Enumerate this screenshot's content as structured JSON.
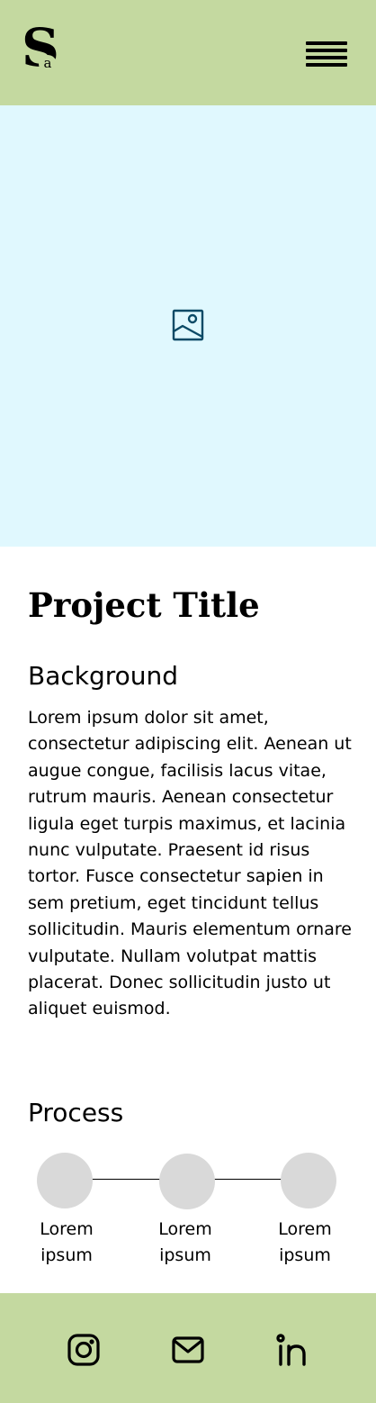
{
  "header": {
    "logo_text_big": "S",
    "logo_text_small": "a",
    "background_color": "#c4d9a0",
    "menu_icon": "hamburger-menu-icon"
  },
  "hero": {
    "background_color": "#e0f8fe",
    "icon": "image-placeholder-icon",
    "icon_color": "#0b4a66"
  },
  "main": {
    "title": "Project Title",
    "background_heading": "Background",
    "background_text": "Lorem ipsum dolor sit amet, consectetur adipiscing elit. Aenean ut augue congue, facilisis lacus vitae, rutrum mauris. Aenean consectetur ligula eget turpis maximus, et lacinia nunc vulputate. Praesent id risus tortor. Fusce consectetur sapien in sem pretium, eget tincidunt tellus sollicitudin. Mauris elementum ornare vulputate. Nullam volutpat mattis placerat. Donec sollicitudin justo ut aliquet euismod.",
    "process_heading": "Process",
    "steps": [
      {
        "label": "Lorem ipsum"
      },
      {
        "label": "Lorem ipsum"
      },
      {
        "label": "Lorem ipsum"
      }
    ],
    "step_circle_color": "#d9d9d9"
  },
  "footer": {
    "background_color": "#c4d9a0",
    "icons": [
      "instagram-icon",
      "mail-icon",
      "linkedin-icon"
    ]
  }
}
